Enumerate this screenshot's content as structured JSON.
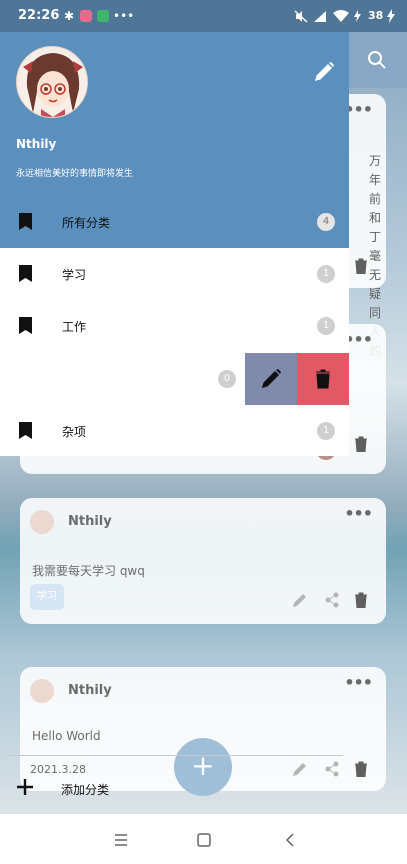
{
  "status_bar": {
    "time": "22:26",
    "battery": "38"
  },
  "background_app": {
    "cards": [
      {
        "peek_text_lines": [
          "万年前",
          "和丁",
          "毫无疑",
          "同人的"
        ]
      },
      {
        "author": "Nthily",
        "content": "我需要每天学习 qwq",
        "tag": "学习"
      },
      {
        "author": "Nthily",
        "content": "Hello World",
        "date": "2021.3.28"
      }
    ],
    "fab_label": "+"
  },
  "drawer": {
    "user_name": "Nthily",
    "user_motto": "永远相信美好的事情即将发生",
    "categories": [
      {
        "label": "所有分类",
        "count": "4"
      },
      {
        "label": "学习",
        "count": "1"
      },
      {
        "label": "工作",
        "count": "1"
      },
      {
        "label": "",
        "count": "0"
      },
      {
        "label": "杂项",
        "count": "1"
      }
    ],
    "add_category_label": "添加分类"
  },
  "colors": {
    "accent": "#5b8fbe",
    "edit_action": "#808bab",
    "delete_action": "#e25966"
  }
}
